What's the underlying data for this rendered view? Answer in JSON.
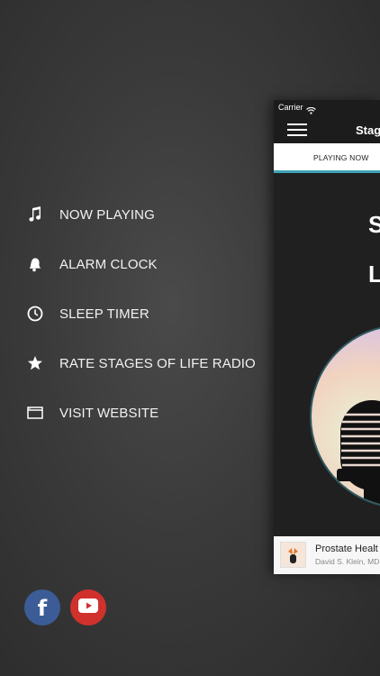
{
  "menu": {
    "items": [
      {
        "label": "NOW PLAYING",
        "icon": "music-note-icon"
      },
      {
        "label": "ALARM CLOCK",
        "icon": "bell-icon"
      },
      {
        "label": "SLEEP TIMER",
        "icon": "clock-icon"
      },
      {
        "label": "RATE STAGES OF LIFE RADIO",
        "icon": "star-icon"
      },
      {
        "label": "VISIT WEBSITE",
        "icon": "browser-window-icon"
      }
    ],
    "social": [
      {
        "icon": "facebook-icon",
        "glyph": "f",
        "color": "#3b5c96"
      },
      {
        "icon": "youtube-icon",
        "color": "#d0312d"
      }
    ]
  },
  "phone": {
    "status": {
      "carrier": "Carrier"
    },
    "header": {
      "title": "Stag"
    },
    "tabs": [
      {
        "label": "PLAYING NOW"
      }
    ],
    "hero": {
      "line1": "S",
      "line2": "L"
    },
    "mini_player": {
      "title": "Prostate Healt",
      "subtitle": "David S. Klein, MD"
    },
    "accent_color": "#3fa3b5"
  }
}
